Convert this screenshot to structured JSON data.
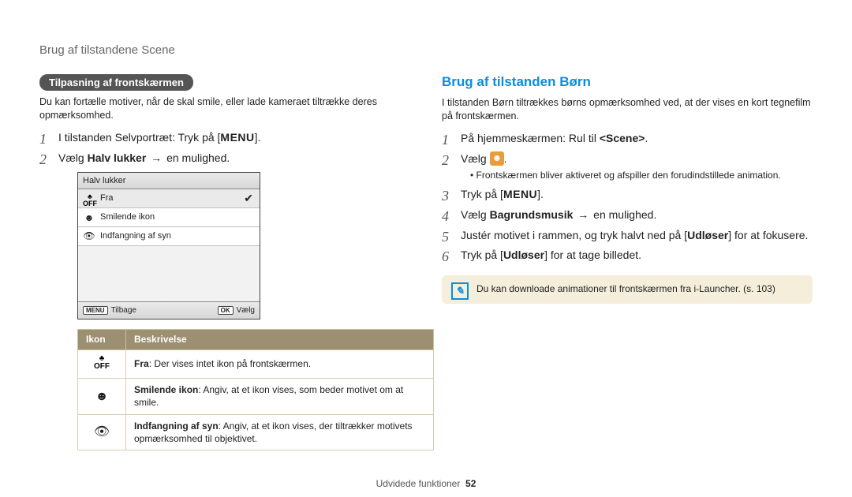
{
  "header": "Brug af tilstandene Scene",
  "left": {
    "pill": "Tilpasning af frontskærmen",
    "intro": "Du kan fortælle motiver, når de skal smile, eller lade kameraet tiltrække deres opmærksomhed.",
    "steps": {
      "s1_pre": "I tilstanden Selvportræt: Tryk på [",
      "s1_menu": "MENU",
      "s1_post": "].",
      "s2_pre": "Vælg ",
      "s2_bold": "Halv lukker",
      "s2_arrow": " → ",
      "s2_post": "en mulighed."
    },
    "mock": {
      "title": "Halv lukker",
      "items": [
        "Fra",
        "Smilende ikon",
        "Indfangning af syn"
      ],
      "footer_left_btn": "MENU",
      "footer_left_txt": "Tilbage",
      "footer_right_btn": "OK",
      "footer_right_txt": "Vælg"
    },
    "table": {
      "h_icon": "Ikon",
      "h_desc": "Beskrivelse",
      "r1_bold": "Fra",
      "r1_rest": ": Der vises intet ikon på frontskærmen.",
      "r2_bold": "Smilende ikon",
      "r2_rest": ": Angiv, at et ikon vises, som beder motivet om at smile.",
      "r3_bold": "Indfangning af syn",
      "r3_rest": ": Angiv, at et ikon vises, der tiltrækker motivets opmærksomhed til objektivet."
    }
  },
  "right": {
    "title": "Brug af tilstanden Børn",
    "intro": "I tilstanden Børn tiltrækkes børns opmærksomhed ved, at der vises en kort tegnefilm på frontskærmen.",
    "steps": {
      "s1_pre": "På hjemmeskærmen: Rul til ",
      "s1_scene": "<Scene>",
      "s1_post": ".",
      "s2_pre": "Vælg ",
      "s2_post": ".",
      "s2_sub": "Frontskærmen bliver aktiveret og afspiller den forudindstillede animation.",
      "s3_pre": "Tryk på [",
      "s3_menu": "MENU",
      "s3_post": "].",
      "s4_pre": "Vælg ",
      "s4_bold": "Bagrundsmusik",
      "s4_arrow": " → ",
      "s4_post": "en mulighed.",
      "s5_pre": "Justér motivet i rammen, og tryk halvt ned på [",
      "s5_bold": "Udløser",
      "s5_post": "] for at fokusere.",
      "s6_pre": "Tryk på [",
      "s6_bold": "Udløser",
      "s6_post": "] for at tage billedet."
    },
    "note": "Du kan downloade animationer til frontskærmen fra i-Launcher. (s. 103)"
  },
  "footer": {
    "section": "Udvidede funktioner",
    "page": "52"
  }
}
